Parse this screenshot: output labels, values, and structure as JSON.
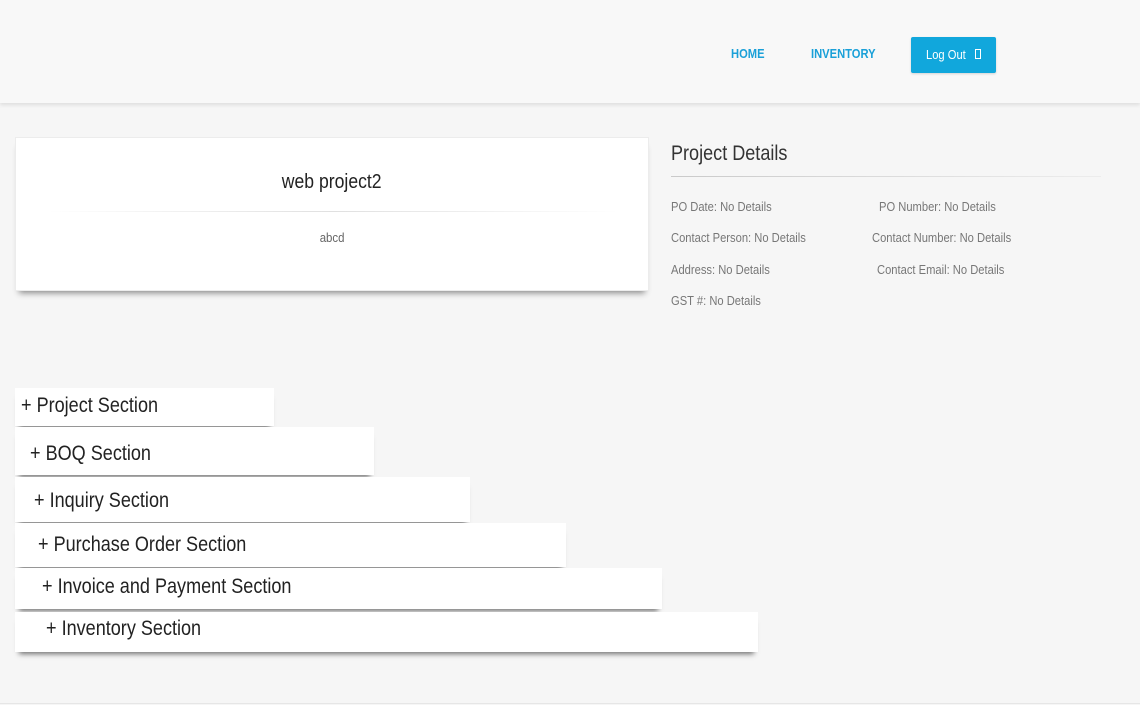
{
  "nav": {
    "home": "HOME",
    "inventory": "INVENTORY",
    "logout": "Log Out"
  },
  "project": {
    "title": "web project2",
    "description": "abcd"
  },
  "details": {
    "title": "Project Details",
    "po_date": "PO Date: No Details",
    "po_number": "PO Number: No Details",
    "contact_person": "Contact Person: No Details",
    "contact_number": "Contact Number: No Details",
    "address": "Address: No Details",
    "contact_email": "Contact Email: No Details",
    "gst": "GST #: No Details"
  },
  "sections": [
    "+ Project Section",
    "+ BOQ Section",
    "+ Inquiry Section",
    "+ Purchase Order Section",
    "+ Invoice and Payment Section",
    "+ Inventory Section"
  ],
  "colors": {
    "accent": "#11a7dc",
    "link": "#1aa0d8",
    "background": "#f6f6f6"
  },
  "icons": {
    "logout": "logout-icon"
  }
}
